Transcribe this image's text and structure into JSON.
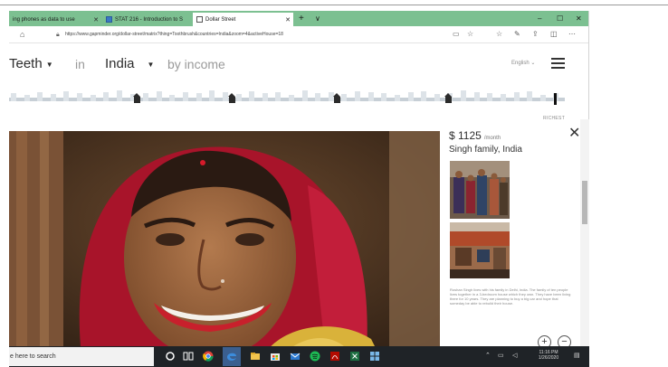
{
  "browser": {
    "tabs": [
      {
        "title": "ing phones as data to use",
        "active": false
      },
      {
        "title": "STAT 216 - Introduction to S",
        "active": false
      },
      {
        "title": "Dollar Street",
        "active": true
      }
    ],
    "new_tab_symbol": "+",
    "tab_list_symbol": "∨",
    "window_controls": {
      "minimize": "–",
      "maximize": "☐",
      "close": "✕"
    },
    "url": "https://www.gapminder.org/dollar-street/matrix?thing=Toothbrush&countries=India&zoom=4&activeHouse=18"
  },
  "page": {
    "thing": "Teeth",
    "word_in": "in",
    "country": "India",
    "word_by_income": "by income",
    "language": "English",
    "dropdown_caret": "▼",
    "richest_label": "RICHEST"
  },
  "income_slider": {
    "selected_fraction": 0.98,
    "marker_fractions": [
      0.23,
      0.4,
      0.59,
      0.79
    ]
  },
  "family": {
    "income": "$ 1125",
    "period": "/month",
    "name": "Singh family, India",
    "description": "Roshan Singh lives with his family in Delhi, India. The family of ten people lives together in a 3-bedroom house which they own. They have been living there for 10 years. They are planning to buy a big car and hope that someday be able to rebuild their house."
  },
  "controls": {
    "close": "✕",
    "zoom_in": "+",
    "zoom_out": "−"
  },
  "taskbar": {
    "search_placeholder": "e here to search",
    "time": "11:16 PM",
    "date": "1/26/2020"
  },
  "colors": {
    "tab_bar": "#7cc091",
    "taskbar": "#1f2327",
    "accent_text": "#2c2c2c",
    "muted_text": "#9a9a9a"
  }
}
